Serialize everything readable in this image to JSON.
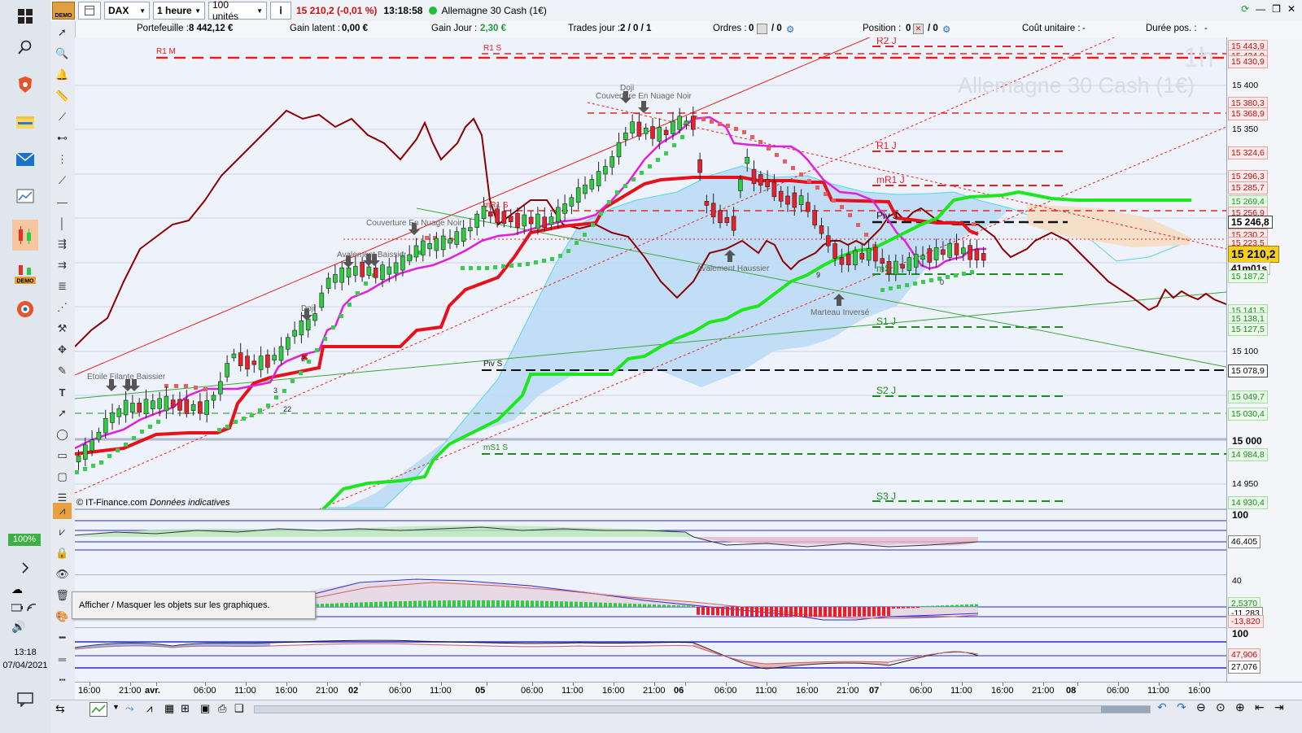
{
  "topbar": {
    "symbol": "DAX",
    "timeframe": "1 heure",
    "quantity": "100 unités",
    "price_change": "15 210,2 (-0,01 %)",
    "time": "13:18:58",
    "instrument": "Allemagne 30 Cash (1€)",
    "demo_badge": "DEMO"
  },
  "infobar": {
    "portefeuille_label": "Portefeuille :",
    "portefeuille_value": "8 442,12 €",
    "gain_latent_label": "Gain latent :",
    "gain_latent_value": "0,00 €",
    "gain_jour_label": "Gain Jour :",
    "gain_jour_value": "2,30 €",
    "trades_label": "Trades jour :",
    "trades_value": "2 / 0 / 1",
    "ordres_label": "Ordres :",
    "ordres_value": "0",
    "ordres_value2": "/ 0",
    "position_label": "Position :",
    "position_value": "0",
    "position_value2": "/ 0",
    "cout_label": "Coût unitaire :",
    "cout_value": "-",
    "duree_label": "Durée pos. :",
    "duree_value": "-"
  },
  "chart": {
    "watermark_tf": "1h",
    "watermark_name": "Allemagne 30 Cash (1€)",
    "copyright": "© IT-Finance.com",
    "copyright_note": "Données indicatives",
    "levels": {
      "r2j": "R2 J",
      "r1m": "R1 M",
      "r1s": "R1 S",
      "r1j": "R1 J",
      "mr1j": "mR1 J",
      "mr1s": "mR1 S",
      "pivj": "Piv J",
      "ms": "mS",
      "s1j": "S1 J",
      "pivs": "Piv S",
      "s2j": "S2 J",
      "ms1s": "mS1 S",
      "s3j": "S3 J"
    },
    "patterns": {
      "doji1": "Doji",
      "couverture1": "Couverture En Nuage Noir",
      "couverture2": "Couverture En Nuage Noir",
      "avalement_haussier": "Avalement Haussier",
      "marteau_inverse": "Marteau Inversé",
      "doji2": "Doji",
      "avalement_baissier": "Avalement Baissier",
      "etoile": "Etoile Filante Baissier"
    },
    "counts": [
      "3",
      "3",
      "22",
      "9",
      "0"
    ]
  },
  "price_axis": {
    "labels": [
      "15 443,9",
      "15 434,9",
      "15 430,9",
      "15 400",
      "15 380,3",
      "15 368,9",
      "15 350",
      "15 324,6",
      "15 296,3",
      "15 285,7",
      "15 269,4",
      "15 256,9",
      "15 246,8",
      "15 230,2",
      "15 223,5",
      "15 210,2",
      "41m01s",
      "15 187,2",
      "15 141,5",
      "15 138,1",
      "15 127,5",
      "15 100",
      "15 078,9",
      "15 049,7",
      "15 030,4",
      "15 000",
      "14 984,8",
      "14 950",
      "14 930,4"
    ],
    "ind1": [
      "100",
      "46,405"
    ],
    "ind2": [
      "40",
      "2,5370",
      "-11,283",
      "-13,820"
    ],
    "ind3": [
      "100",
      "47,906",
      "27,076"
    ]
  },
  "time_axis": [
    "16:00",
    "21:00",
    "avr.",
    "06:00",
    "11:00",
    "16:00",
    "21:00",
    "02",
    "06:00",
    "11:00",
    "05",
    "06:00",
    "11:00",
    "16:00",
    "21:00",
    "06",
    "06:00",
    "11:00",
    "16:00",
    "21:00",
    "07",
    "06:00",
    "11:00",
    "16:00",
    "21:00",
    "08",
    "06:00",
    "11:00",
    "16:00"
  ],
  "taskbar": {
    "zoom": "100%",
    "clock_time": "13:18",
    "clock_date": "07/04/2021"
  },
  "tooltip": "Afficher / Masquer les objets sur les graphiques.",
  "colors": {
    "up_candle": "#2ecc40",
    "down_candle": "#e8202a",
    "kijun": "#e8101a",
    "tenkan": "#e020e0",
    "chikou": "#8b0000",
    "senkou_b": "#00e000",
    "cloud": "#bcdcf5"
  }
}
